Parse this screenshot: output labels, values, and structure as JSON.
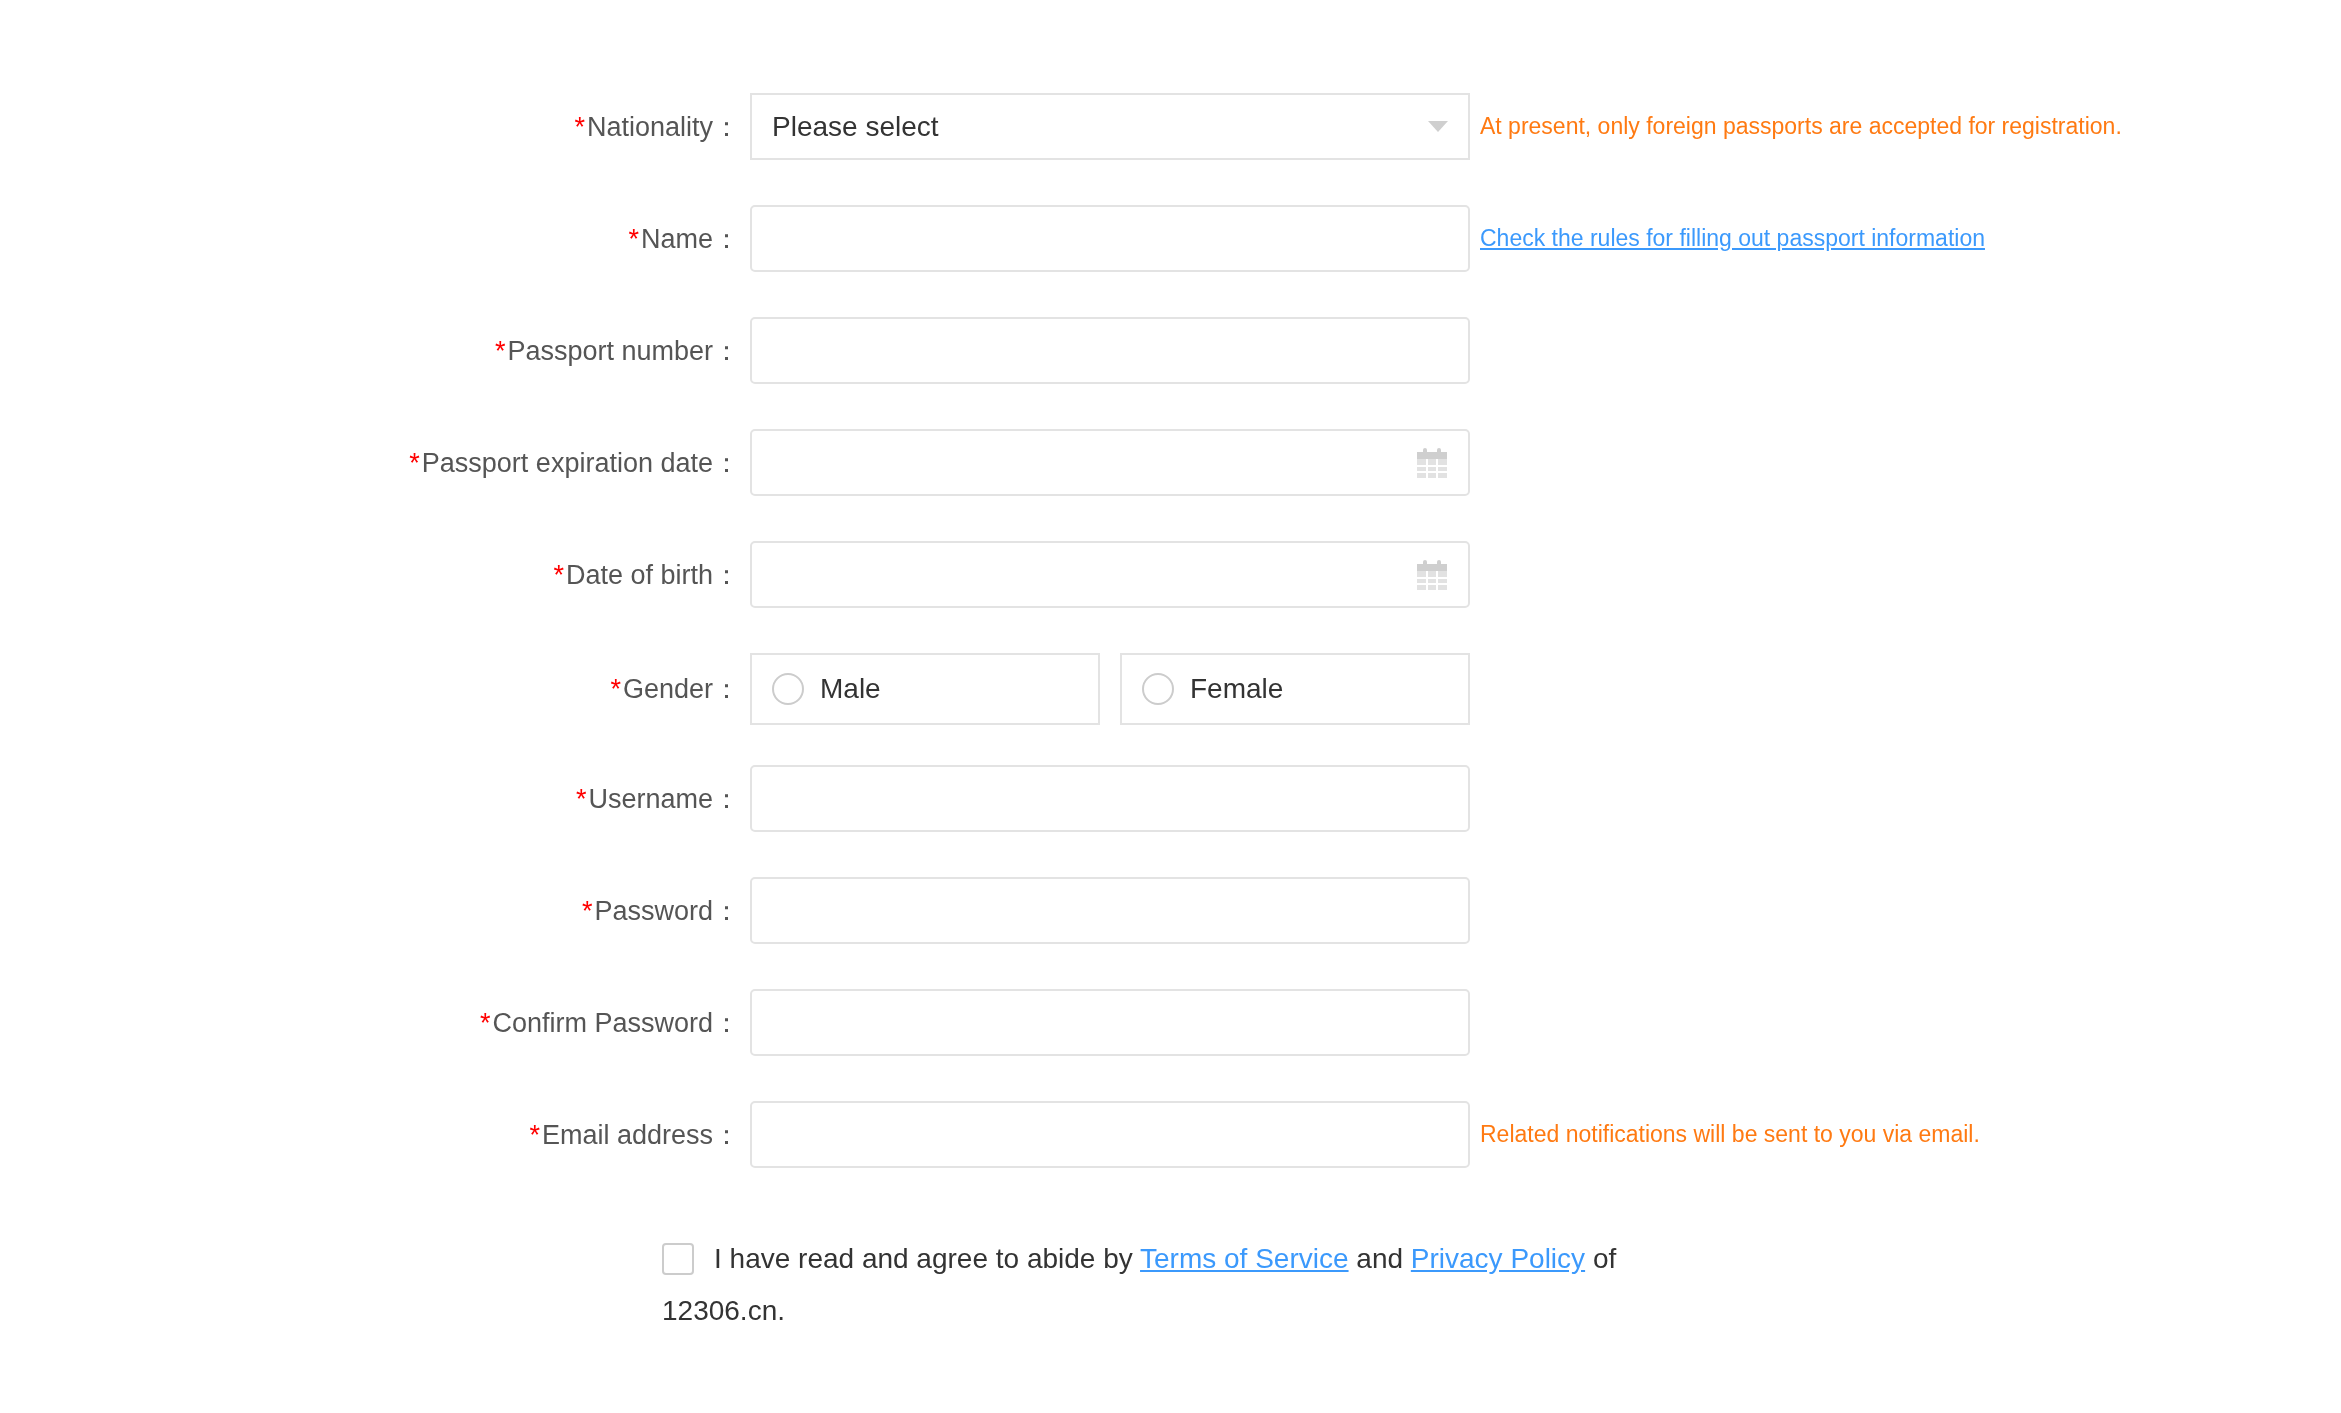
{
  "fields": [
    {
      "kind": "select",
      "mark": "*",
      "label": "Nationality：",
      "value": "Please select",
      "hint": {
        "kind": "note",
        "text": "At present, only foreign passports are accepted for registration."
      }
    },
    {
      "kind": "text",
      "mark": "*",
      "label": "Name：",
      "hint": {
        "kind": "link",
        "text": "Check the rules for filling out passport information"
      }
    },
    {
      "kind": "text",
      "mark": "*",
      "label": "Passport number："
    },
    {
      "kind": "date",
      "mark": "*",
      "label": "Passport expiration date："
    },
    {
      "kind": "date",
      "mark": "*",
      "label": "Date of birth："
    },
    {
      "kind": "radio",
      "mark": "*",
      "label": "Gender：",
      "options": [
        {
          "label": "Male",
          "selected": false
        },
        {
          "label": "Female",
          "selected": false
        }
      ]
    },
    {
      "kind": "text",
      "mark": "*",
      "label": "Username："
    },
    {
      "kind": "password",
      "mark": "*",
      "label": "Password："
    },
    {
      "kind": "password",
      "mark": "*",
      "label": "Confirm Password："
    },
    {
      "kind": "text",
      "mark": "*",
      "label": "Email address：",
      "hint": {
        "kind": "note",
        "text": "Related notifications will be sent to you via email."
      }
    }
  ],
  "agreement": {
    "checked": false,
    "before": "I have read and agree to abide by",
    "terms": "Terms of Service",
    "middle": "and",
    "privacy": "Privacy Policy",
    "after": "of",
    "continuation": "12306.cn."
  }
}
